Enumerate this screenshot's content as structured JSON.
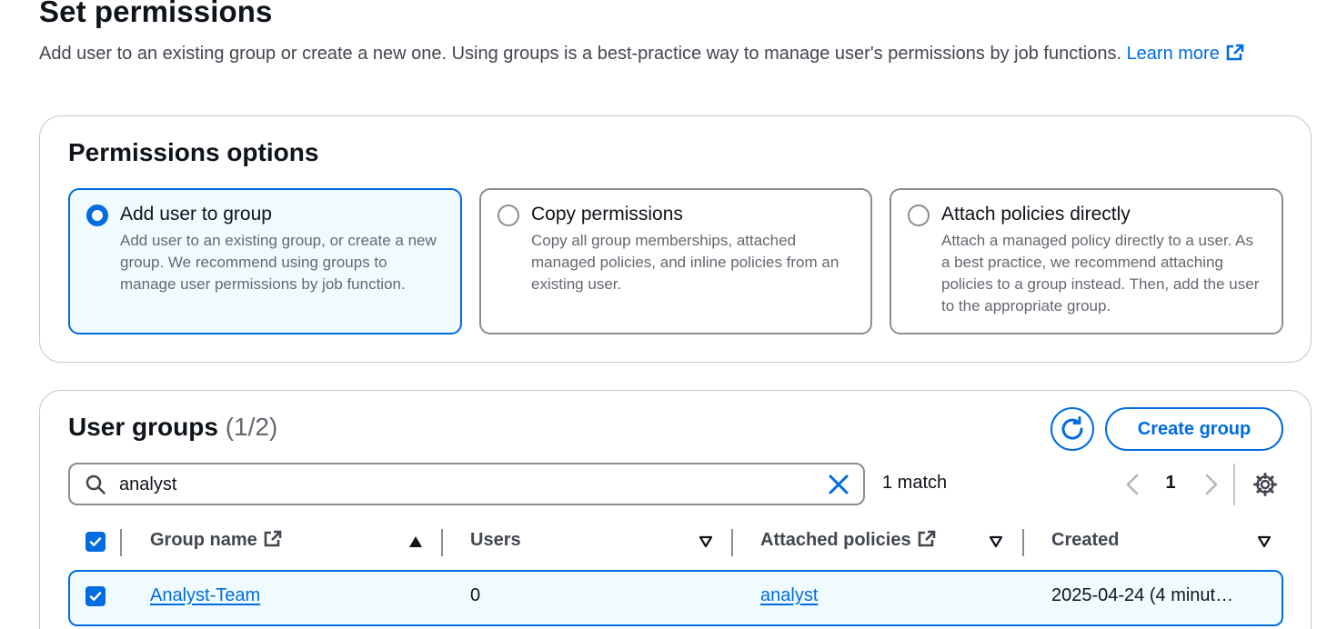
{
  "header": {
    "title": "Set permissions",
    "description": "Add user to an existing group or create a new one. Using groups is a best-practice way to manage user's permissions by job functions.",
    "learn_more": "Learn more"
  },
  "permissions_options": {
    "title": "Permissions options",
    "options": [
      {
        "label": "Add user to group",
        "description": "Add user to an existing group, or create a new group. We recommend using groups to manage user permissions by job function.",
        "selected": true
      },
      {
        "label": "Copy permissions",
        "description": "Copy all group memberships, attached managed policies, and inline policies from an existing user.",
        "selected": false
      },
      {
        "label": "Attach policies directly",
        "description": "Attach a managed policy directly to a user. As a best practice, we recommend attaching policies to a group instead. Then, add the user to the appropriate group.",
        "selected": false
      }
    ]
  },
  "user_groups": {
    "title": "User groups",
    "count": "(1/2)",
    "create_button": "Create group",
    "search_value": "analyst",
    "match_count": "1 match",
    "page": "1",
    "columns": [
      "Group name",
      "Users",
      "Attached policies",
      "Created"
    ],
    "rows": [
      {
        "group_name": "Analyst-Team",
        "users": "0",
        "policies": "analyst",
        "created": "2025-04-24 (4 minut…",
        "selected": true
      }
    ]
  },
  "colors": {
    "accent": "#006ce0",
    "selected_bg": "#f0fbff",
    "border": "#8c8c94",
    "text": "#0f141a",
    "muted": "#656871"
  }
}
